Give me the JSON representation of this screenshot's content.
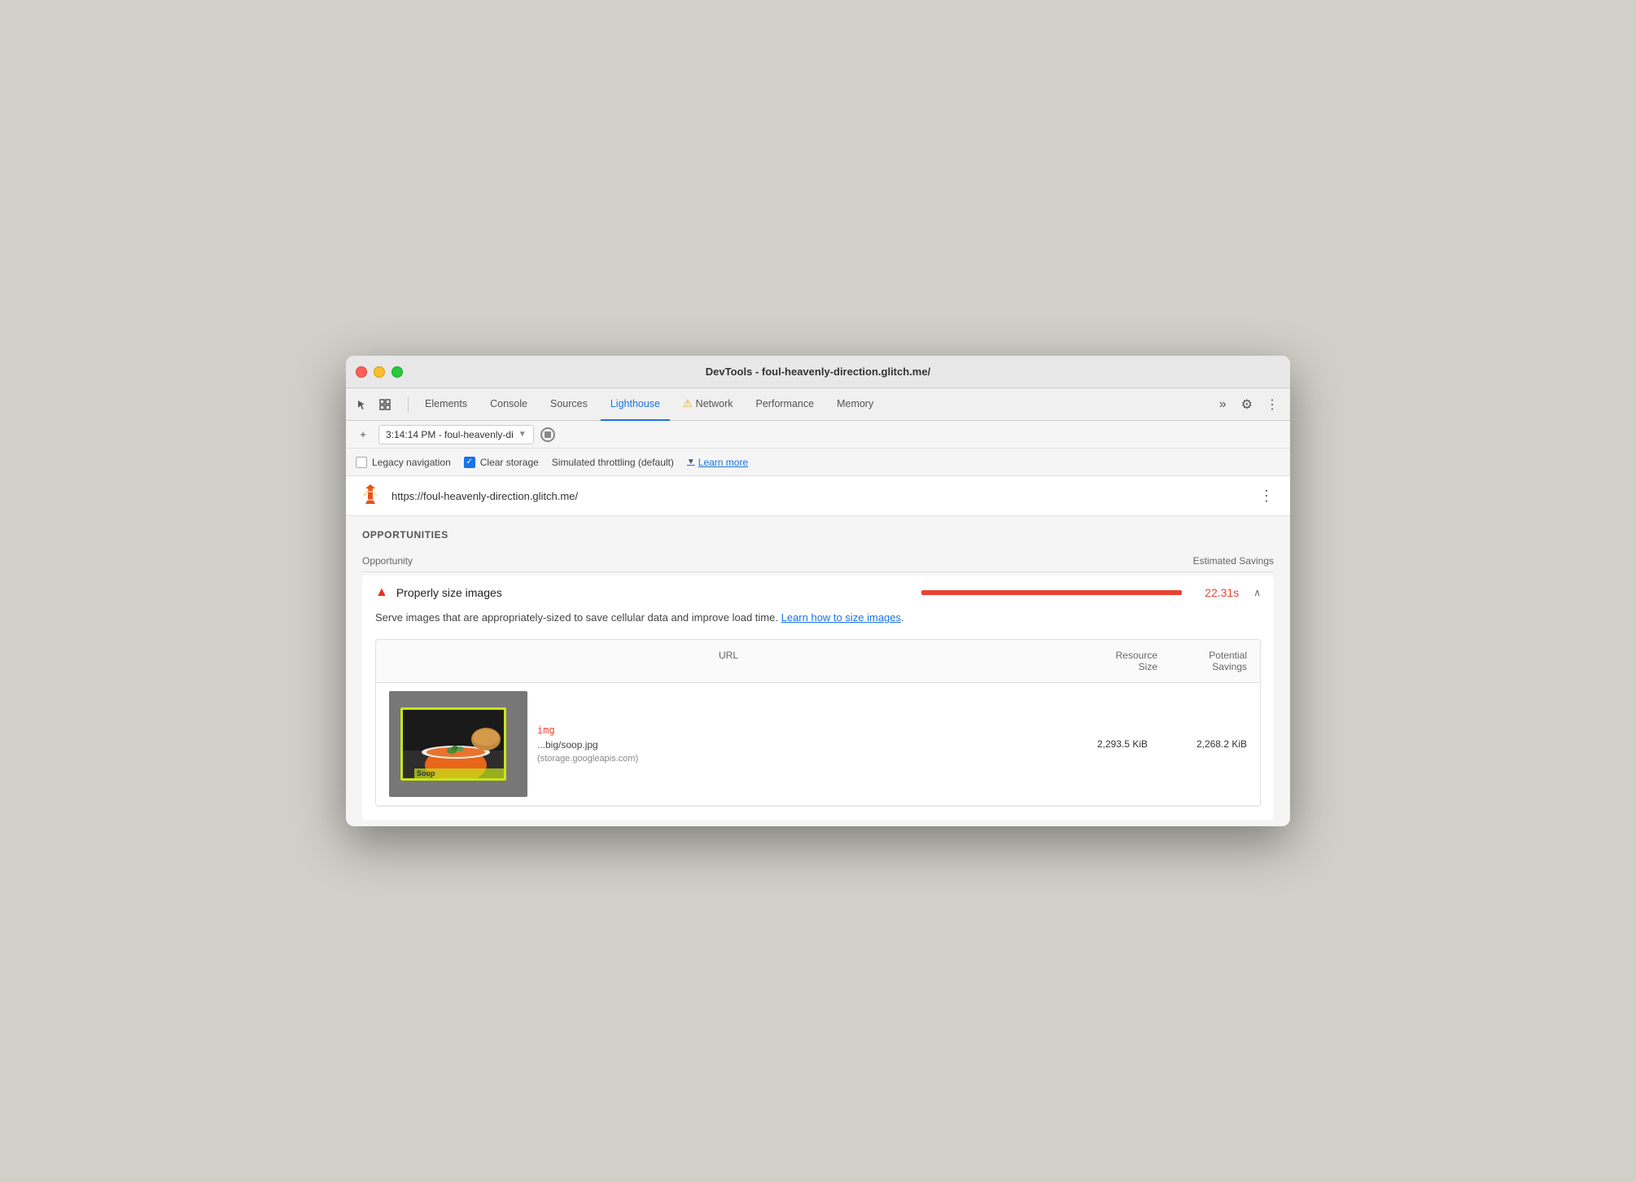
{
  "window": {
    "title": "DevTools - foul-heavenly-direction.glitch.me/"
  },
  "tabs": [
    {
      "id": "elements",
      "label": "Elements",
      "active": false
    },
    {
      "id": "console",
      "label": "Console",
      "active": false
    },
    {
      "id": "sources",
      "label": "Sources",
      "active": false
    },
    {
      "id": "lighthouse",
      "label": "Lighthouse",
      "active": true
    },
    {
      "id": "network",
      "label": "Network",
      "active": false,
      "warning": true
    },
    {
      "id": "performance",
      "label": "Performance",
      "active": false
    },
    {
      "id": "memory",
      "label": "Memory",
      "active": false
    }
  ],
  "toolbar": {
    "add_icon": "+",
    "url_text": "3:14:14 PM - foul-heavenly-di",
    "more_tabs": "»",
    "gear": "⚙",
    "dots": "⋮"
  },
  "options": {
    "legacy_nav_label": "Legacy navigation",
    "legacy_nav_checked": false,
    "clear_storage_label": "Clear storage",
    "clear_storage_checked": true,
    "throttle_label": "Simulated throttling (default)",
    "learn_more_label": "Learn more"
  },
  "url_section": {
    "url": "https://foul-heavenly-direction.glitch.me/"
  },
  "opportunities": {
    "section_title": "OPPORTUNITIES",
    "col_opportunity": "Opportunity",
    "col_savings": "Estimated Savings",
    "items": [
      {
        "id": "properly-size-images",
        "title": "Properly size images",
        "savings": "22.31s",
        "bar_width": "100%",
        "description": "Serve images that are appropriately-sized to save cellular data and improve load time.",
        "learn_link": "Learn how to size images",
        "table": {
          "col_url": "URL",
          "col_resource": "Resource\nSize",
          "col_potential": "Potential\nSavings",
          "rows": [
            {
              "element_tag": "img",
              "file_url": "...big/soop.jpg",
              "file_source": "(storage.googleapis.com)",
              "resource_size": "2,293.5 KiB",
              "potential_savings": "2,268.2 KiB",
              "thumbnail_label": "Soop"
            }
          ]
        }
      }
    ]
  }
}
